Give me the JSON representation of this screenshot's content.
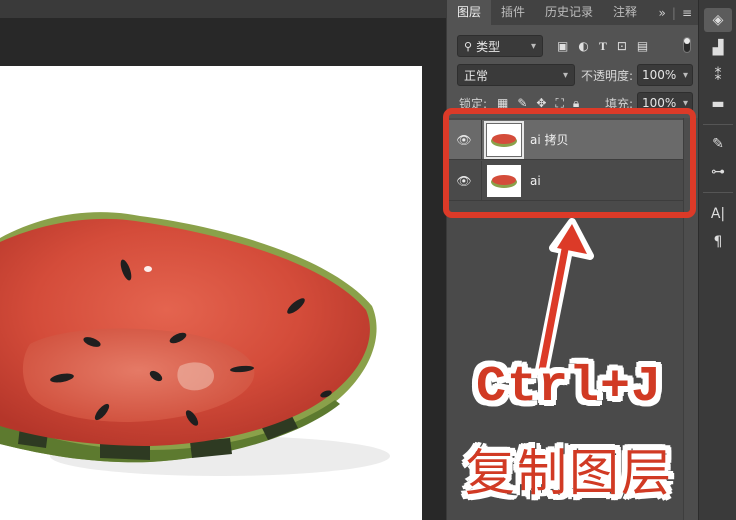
{
  "panel": {
    "tabs": [
      {
        "label": "图层",
        "active": true
      },
      {
        "label": "插件",
        "active": false
      },
      {
        "label": "历史记录",
        "active": false
      },
      {
        "label": "注释",
        "active": false
      }
    ],
    "collapse_icon": "double-chevron-right-icon",
    "menu_icon": "hamburger-menu-icon",
    "filter": {
      "label": "类型",
      "icons": [
        "image-filter-icon",
        "adjustment-filter-icon",
        "type-filter-icon",
        "shape-filter-icon",
        "smart-object-filter-icon"
      ]
    },
    "blend_mode": "正常",
    "opacity": {
      "label": "不透明度:",
      "value": "100%"
    },
    "lock": {
      "label": "锁定:",
      "icons": [
        "lock-pixels-icon",
        "lock-paint-icon",
        "lock-position-icon",
        "lock-artboard-icon",
        "lock-all-icon"
      ]
    },
    "fill": {
      "label": "填充:",
      "value": "100%"
    },
    "layers": [
      {
        "name": "ai 拷贝",
        "visible": true,
        "selected": true
      },
      {
        "name": "ai",
        "visible": true,
        "selected": false
      }
    ]
  },
  "strip_icons": [
    "layers-panel-icon",
    "libraries-icon",
    "channels-icon",
    "comments-icon",
    "brush-settings-icon",
    "adjustments-icon",
    "character-icon",
    "paragraph-icon"
  ],
  "annotation": {
    "shortcut": "Ctrl+J",
    "caption": "复制图层",
    "color": "#dc3a28"
  }
}
